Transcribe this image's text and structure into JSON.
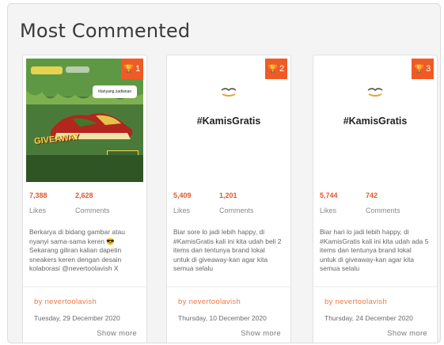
{
  "section_title": "Most Commented",
  "labels": {
    "likes": "Likes",
    "comments": "Comments",
    "show_more": "Show more"
  },
  "cards": [
    {
      "rank": "1",
      "image": {
        "bubble_text": "#tanyang.zadianan",
        "giveaway_text": "GIVEAWAY"
      },
      "likes": "7,388",
      "comments": "2,628",
      "description": "Berkarya di bidang gambar atau nyanyi sama-sama keren 😎 Sekarang giliran kalian dapetin sneakers keren dengan desain kolaborasi @nevertoolavish X",
      "author": "by nevertoolavish",
      "date": "Tuesday, 29 December 2020"
    },
    {
      "rank": "2",
      "image": {
        "headline": "#KamisGratis"
      },
      "likes": "5,409",
      "comments": "1,201",
      "description": "Biar sore lo jadi lebih happy, di #KamisGratis kali ini kita udah beli 2 items dan tentunya brand lokal untuk di giveaway-kan agar kita semua selalu",
      "author": "by nevertoolavish",
      "date": "Thursday, 10 December 2020"
    },
    {
      "rank": "3",
      "image": {
        "headline": "#KamisGratis"
      },
      "likes": "5,744",
      "comments": "742",
      "description": "Biar hari lo jadi lebih happy, di #KamisGratis kali ini kita udah ada 5 items dan tentunya brand lokal untuk di giveaway-kan agar kita semua selalu",
      "author": "by nevertoolavish",
      "date": "Thursday, 24 December 2020"
    }
  ],
  "colors": {
    "accent": "#f05a24",
    "stat_number": "#e4572e",
    "author": "#f07a3f"
  },
  "icons": {
    "rank": "trophy-icon"
  }
}
